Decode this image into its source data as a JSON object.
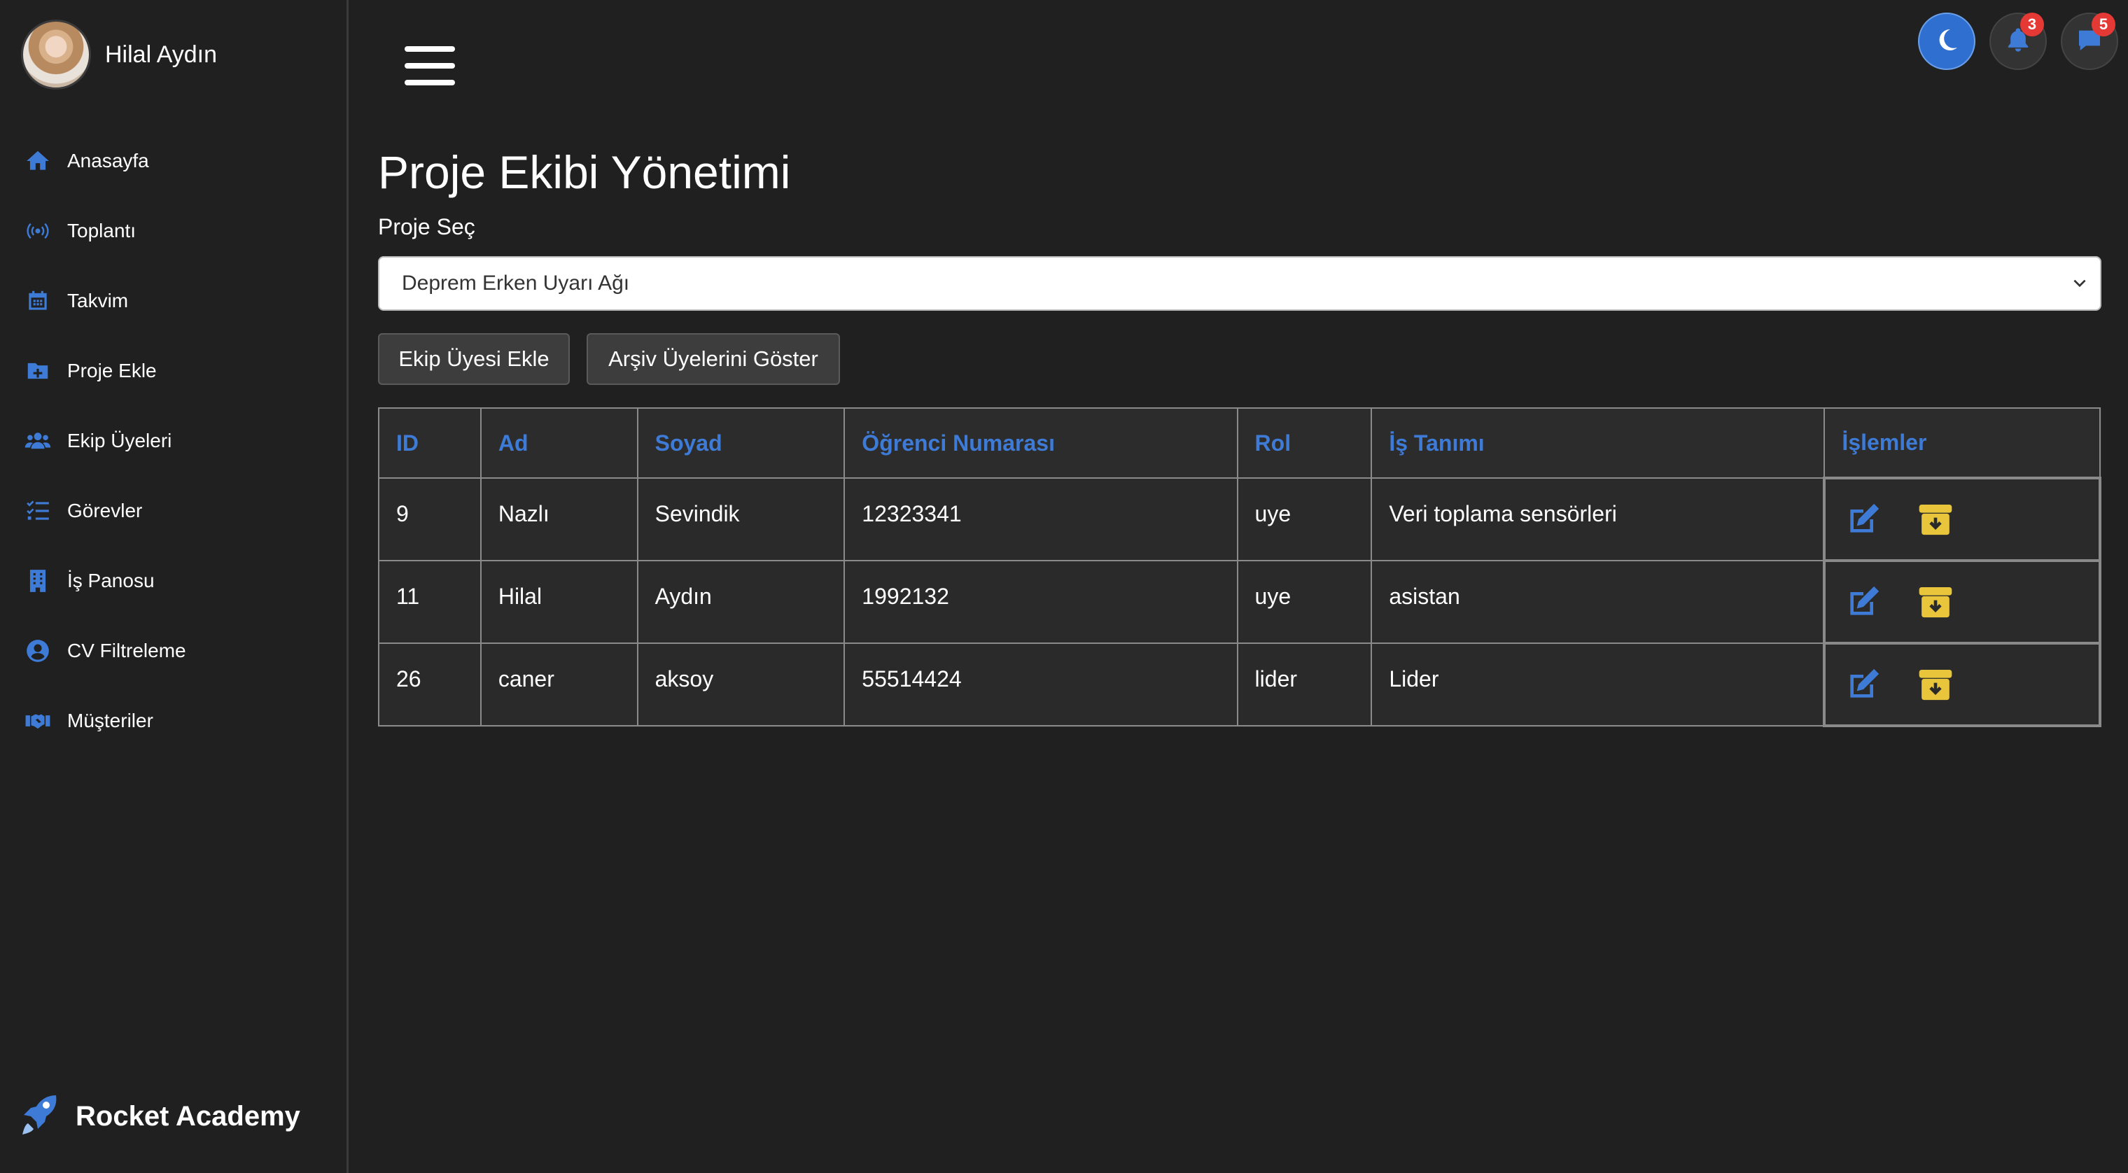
{
  "sidebar": {
    "profile_name": "Hilal Aydın",
    "items": [
      {
        "label": "Anasayfa",
        "icon": "home-icon"
      },
      {
        "label": "Toplantı",
        "icon": "broadcast-icon"
      },
      {
        "label": "Takvim",
        "icon": "calendar-icon"
      },
      {
        "label": "Proje Ekle",
        "icon": "folder-plus-icon"
      },
      {
        "label": "Ekip Üyeleri",
        "icon": "users-icon"
      },
      {
        "label": "Görevler",
        "icon": "list-check-icon"
      },
      {
        "label": "İş Panosu",
        "icon": "building-icon"
      },
      {
        "label": "CV Filtreleme",
        "icon": "user-circle-icon"
      },
      {
        "label": "Müşteriler",
        "icon": "handshake-icon"
      }
    ],
    "brand": "Rocket Academy"
  },
  "topbar": {
    "notifications_count": "3",
    "messages_count": "5"
  },
  "main": {
    "title": "Proje Ekibi Yönetimi",
    "select_label": "Proje Seç",
    "selected_project": "Deprem Erken Uyarı Ağı",
    "add_member_button": "Ekip Üyesi Ekle",
    "show_archive_button": "Arşiv Üyelerini Göster"
  },
  "table": {
    "headers": [
      "ID",
      "Ad",
      "Soyad",
      "Öğrenci Numarası",
      "Rol",
      "İş Tanımı",
      "İşlemler"
    ],
    "rows": [
      {
        "id": "9",
        "ad": "Nazlı",
        "soyad": "Sevindik",
        "ogrenci_no": "12323341",
        "rol": "uye",
        "is_tanimi": "Veri toplama sensörleri"
      },
      {
        "id": "11",
        "ad": "Hilal",
        "soyad": "Aydın",
        "ogrenci_no": "1992132",
        "rol": "uye",
        "is_tanimi": "asistan"
      },
      {
        "id": "26",
        "ad": "caner",
        "soyad": "aksoy",
        "ogrenci_no": "55514424",
        "rol": "lider",
        "is_tanimi": "Lider"
      }
    ]
  },
  "colors": {
    "accent": "#3e7bd6",
    "archive_icon": "#e8c53a",
    "badge": "#e53935",
    "background": "#202020"
  }
}
